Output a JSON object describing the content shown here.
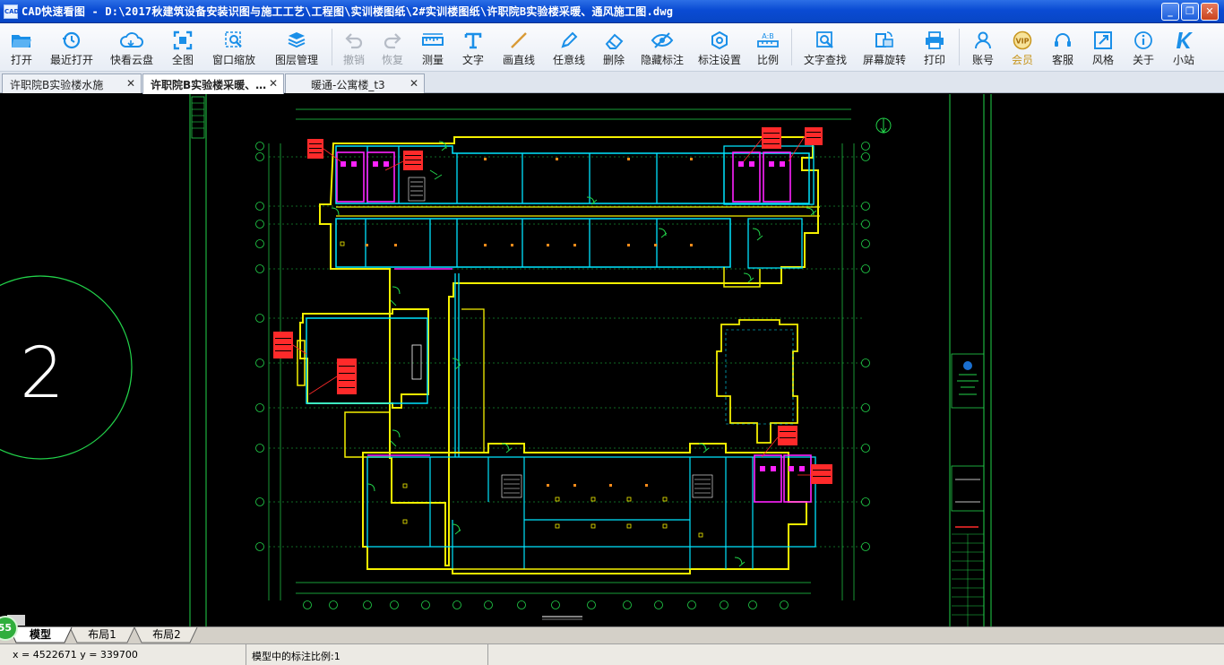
{
  "window": {
    "title": "CAD快速看图 - D:\\2017秋建筑设备安装识图与施工工艺\\工程图\\实训楼图纸\\2#实训楼图纸\\许职院B实验楼采暖、通风施工图.dwg",
    "app_icon_text": "CAD",
    "minimize": "_",
    "maximize": "❐",
    "close": "✕"
  },
  "toolbar": {
    "items": [
      {
        "label": "打开",
        "icon": "folder-open-icon",
        "enabled": true
      },
      {
        "label": "最近打开",
        "icon": "history-icon",
        "enabled": true
      },
      {
        "label": "快看云盘",
        "icon": "cloud-icon",
        "enabled": true
      },
      {
        "label": "全图",
        "icon": "fit-all-icon",
        "enabled": true
      },
      {
        "label": "窗口缩放",
        "icon": "zoom-window-icon",
        "enabled": true
      },
      {
        "label": "图层管理",
        "icon": "layers-icon",
        "enabled": true
      },
      {
        "label": "撤销",
        "icon": "undo-icon",
        "enabled": false
      },
      {
        "label": "恢复",
        "icon": "redo-icon",
        "enabled": false
      },
      {
        "label": "测量",
        "icon": "ruler-icon",
        "enabled": true
      },
      {
        "label": "文字",
        "icon": "text-icon",
        "enabled": true
      },
      {
        "label": "画直线",
        "icon": "line-icon",
        "enabled": true
      },
      {
        "label": "任意线",
        "icon": "pen-icon",
        "enabled": true
      },
      {
        "label": "删除",
        "icon": "eraser-icon",
        "enabled": true
      },
      {
        "label": "隐藏标注",
        "icon": "hide-eye-icon",
        "enabled": true
      },
      {
        "label": "标注设置",
        "icon": "settings-icon",
        "enabled": true
      },
      {
        "label": "比例",
        "icon": "scale-icon",
        "enabled": true
      },
      {
        "label": "文字查找",
        "icon": "text-search-icon",
        "enabled": true
      },
      {
        "label": "屏幕旋转",
        "icon": "rotate-icon",
        "enabled": true
      },
      {
        "label": "打印",
        "icon": "printer-icon",
        "enabled": true
      },
      {
        "label": "账号",
        "icon": "user-icon",
        "enabled": true
      },
      {
        "label": "会员",
        "icon": "vip-icon",
        "enabled": true
      },
      {
        "label": "客服",
        "icon": "headset-icon",
        "enabled": true
      },
      {
        "label": "风格",
        "icon": "style-icon",
        "enabled": true
      },
      {
        "label": "关于",
        "icon": "info-icon",
        "enabled": true
      },
      {
        "label": "小站",
        "icon": "k-logo-icon",
        "enabled": true
      }
    ],
    "vip_text": "VIP",
    "scale_icon_text": "A:B"
  },
  "tabs": [
    {
      "label": "许职院B实验楼水施",
      "active": false,
      "close": "✕"
    },
    {
      "label": "许职院B实验楼采暖、…",
      "active": true,
      "close": "✕"
    },
    {
      "label": "暖通-公寓楼_t3",
      "active": false,
      "close": "✕"
    }
  ],
  "drawing": {
    "viewport_label": "2",
    "north_arrow": "N"
  },
  "layout_tabs": [
    {
      "label": "模型",
      "active": true
    },
    {
      "label": "布局1",
      "active": false
    },
    {
      "label": "布局2",
      "active": false
    }
  ],
  "status": {
    "coordinates": "x = 4522671  y = 339700",
    "scale_text": "模型中的标注比例:1",
    "badge": "55"
  },
  "colors": {
    "wall_cyan": "#00e5ff",
    "wall_yellow": "#f5f000",
    "dim_green": "#22d34a",
    "annotation_red": "#ff2a2a",
    "fixture_magenta": "#ff22ff",
    "accent_blue": "#1a8fe8"
  }
}
